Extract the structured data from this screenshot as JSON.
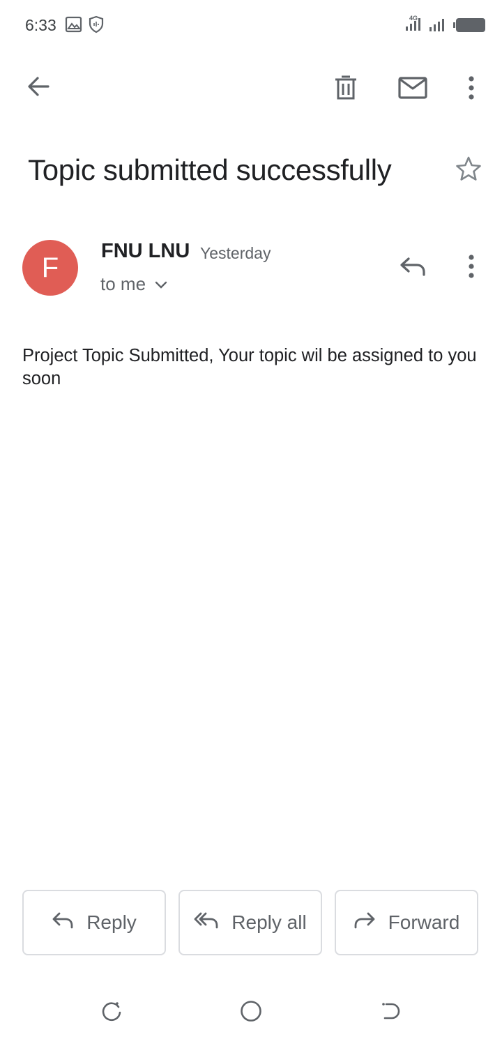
{
  "status_bar": {
    "time": "6:33",
    "network": "4G",
    "icons": [
      "gallery-icon",
      "shield-icon",
      "signal-4g-icon",
      "signal-icon",
      "battery-icon"
    ]
  },
  "toolbar": {
    "icons": [
      "back-arrow-icon",
      "delete-icon",
      "mark-unread-icon",
      "more-vert-icon"
    ]
  },
  "email": {
    "subject": "Topic submitted successfully",
    "sender_initial": "F",
    "sender_name": "FNU LNU",
    "time": "Yesterday",
    "recipient": "to me",
    "body": "Project Topic Submitted, Your topic wil be assigned to you soon",
    "avatar_color": "#e05d55"
  },
  "actions": {
    "reply": "Reply",
    "reply_all": "Reply all",
    "forward": "Forward"
  },
  "nav_bar": {
    "icons": [
      "recents-icon",
      "home-icon",
      "back-icon"
    ]
  }
}
